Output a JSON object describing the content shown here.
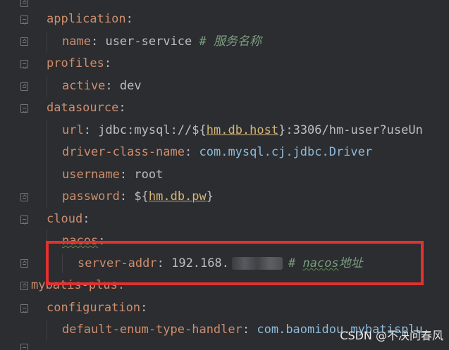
{
  "editor": {
    "lines": {
      "l1": {
        "key": "application",
        "colon": ":"
      },
      "l2": {
        "key": "name",
        "colon": ":",
        "value": "user-service",
        "comment_hash": "#",
        "comment": "服务名称"
      },
      "l3": {
        "key": "profiles",
        "colon": ":"
      },
      "l4": {
        "key": "active",
        "colon": ":",
        "value": "dev"
      },
      "l5": {
        "key": "datasource",
        "colon": ":"
      },
      "l6": {
        "key": "url",
        "colon": ":",
        "prefix": "jdbc:mysql://${",
        "link": "hm.db.host",
        "suffix": "}:3306/hm-user?useUn"
      },
      "l7": {
        "key": "driver-class-name",
        "colon": ":",
        "value": "com.mysql.cj.jdbc.Driver"
      },
      "l8": {
        "key": "username",
        "colon": ":",
        "value": "root"
      },
      "l9": {
        "key": "password",
        "colon": ":",
        "prefix": "${",
        "link": "hm.db.pw",
        "suffix": "}"
      },
      "l10": {
        "key": "cloud",
        "colon": ":"
      },
      "l11": {
        "key": "nacos",
        "colon": ":"
      },
      "l12": {
        "key": "server-addr",
        "colon": ":",
        "value": "192.168.",
        "comment_hash": "#",
        "comment_word": "nacos",
        "comment_cn": "地址"
      },
      "l13": {
        "text": "mybatis-plus:"
      },
      "l14": {
        "key": "configuration",
        "colon": ":"
      },
      "l15": {
        "key": "default-enum-type-handler",
        "colon": ":",
        "value": "com.baomidou.mybatisplu"
      }
    }
  },
  "watermark": "CSDN @不决问春风",
  "colors": {
    "highlight_border": "#e5302e",
    "background": "#2b2d30"
  }
}
